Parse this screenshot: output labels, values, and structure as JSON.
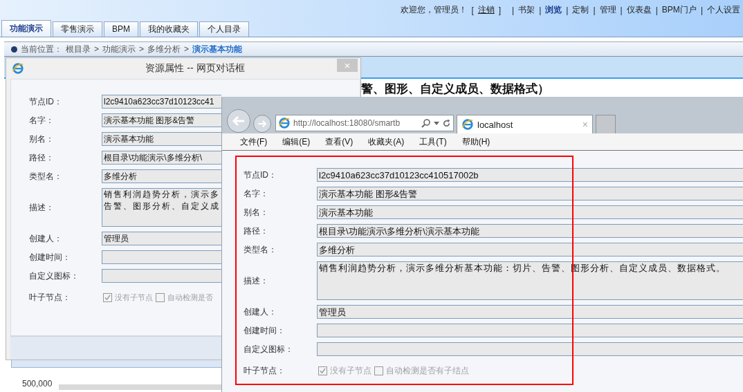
{
  "header": {
    "welcome": "欢迎您，管理员！",
    "bracket_open": "[",
    "logout": "注销",
    "bracket_close": "]",
    "separator": "|",
    "links": [
      {
        "label": "书架",
        "selected": false
      },
      {
        "label": "浏览",
        "selected": true
      },
      {
        "label": "定制",
        "selected": false
      },
      {
        "label": "管理",
        "selected": false
      },
      {
        "label": "仪表盘",
        "selected": false
      },
      {
        "label": "BPM门户",
        "selected": false
      },
      {
        "label": "个人设置",
        "selected": false
      }
    ]
  },
  "tabs": [
    {
      "label": "功能演示",
      "selected": true
    },
    {
      "label": "零售演示",
      "selected": false
    },
    {
      "label": "BPM",
      "selected": false
    },
    {
      "label": "我的收藏夹",
      "selected": false
    },
    {
      "label": "个人目录",
      "selected": false
    }
  ],
  "breadcrumb": {
    "prefix": "当前位置：",
    "separator": ">",
    "path": [
      "根目录",
      "功能演示",
      "多维分析"
    ],
    "current": "演示基本功能"
  },
  "heading": "警、图形、自定义成员、数据格式）",
  "chart": {
    "axis_label": "500,000"
  },
  "dialog": {
    "title": "资源属性 -- 网页对话框",
    "close": "×",
    "fields": [
      {
        "kind": "input",
        "label": "节点ID：",
        "lines": [
          "l2c9410a623cc37d10123cc41"
        ]
      },
      {
        "kind": "input",
        "label": "名字：",
        "lines": [
          "演示基本功能  图形&告警"
        ]
      },
      {
        "kind": "input",
        "label": "别名：",
        "lines": [
          "演示基本功能"
        ]
      },
      {
        "kind": "input",
        "label": "路径：",
        "lines": [
          "根目录\\功能演示\\多维分析\\"
        ]
      },
      {
        "kind": "input",
        "label": "类型名：",
        "lines": [
          "多维分析"
        ]
      },
      {
        "kind": "textarea",
        "label": "描述：",
        "lines": [
          "销售利润趋势分析，演示多",
          "告警、图形分析、自定义成"
        ]
      },
      {
        "kind": "input",
        "label": "创建人：",
        "lines": [
          "管理员"
        ]
      },
      {
        "kind": "input",
        "label": "创建时间："
      },
      {
        "kind": "input",
        "label": "自定义图标："
      },
      {
        "kind": "checks",
        "label": "叶子节点：",
        "options": [
          {
            "label": "没有子节点",
            "checked": true
          },
          {
            "label": "自动检测是否",
            "checked": false
          }
        ]
      }
    ]
  },
  "browser": {
    "address": "http://localhost:18080/smartb",
    "tab": "localhost",
    "tab_close": "×",
    "menu": [
      "文件(F)",
      "编辑(E)",
      "查看(V)",
      "收藏夹(A)",
      "工具(T)",
      "帮助(H)"
    ],
    "fields": [
      {
        "kind": "input",
        "label": "节点ID：",
        "lines": [
          "l2c9410a623cc37d10123cc410517002b"
        ]
      },
      {
        "kind": "input",
        "label": "名字：",
        "lines": [
          "演示基本功能  图形&告警"
        ]
      },
      {
        "kind": "input",
        "label": "别名：",
        "lines": [
          "演示基本功能"
        ]
      },
      {
        "kind": "input",
        "label": "路径：",
        "lines": [
          "根目录\\功能演示\\多维分析\\演示基本功能"
        ]
      },
      {
        "kind": "input",
        "label": "类型名：",
        "lines": [
          "多维分析"
        ]
      },
      {
        "kind": "textarea",
        "label": "描述：",
        "lines": [
          "销售利润趋势分析，演示多维分析基本功能：切片、告警、图形分析、自定义成员、数据格式。"
        ]
      },
      {
        "kind": "input",
        "label": "创建人：",
        "lines": [
          "管理员"
        ]
      },
      {
        "kind": "input",
        "label": "创建时间："
      },
      {
        "kind": "input",
        "label": "自定义图标："
      },
      {
        "kind": "checks",
        "label": "叶子节点：",
        "options": [
          {
            "label": "没有子节点",
            "checked": true
          },
          {
            "label": "自动检测是否有子结点",
            "checked": false
          }
        ]
      }
    ]
  }
}
